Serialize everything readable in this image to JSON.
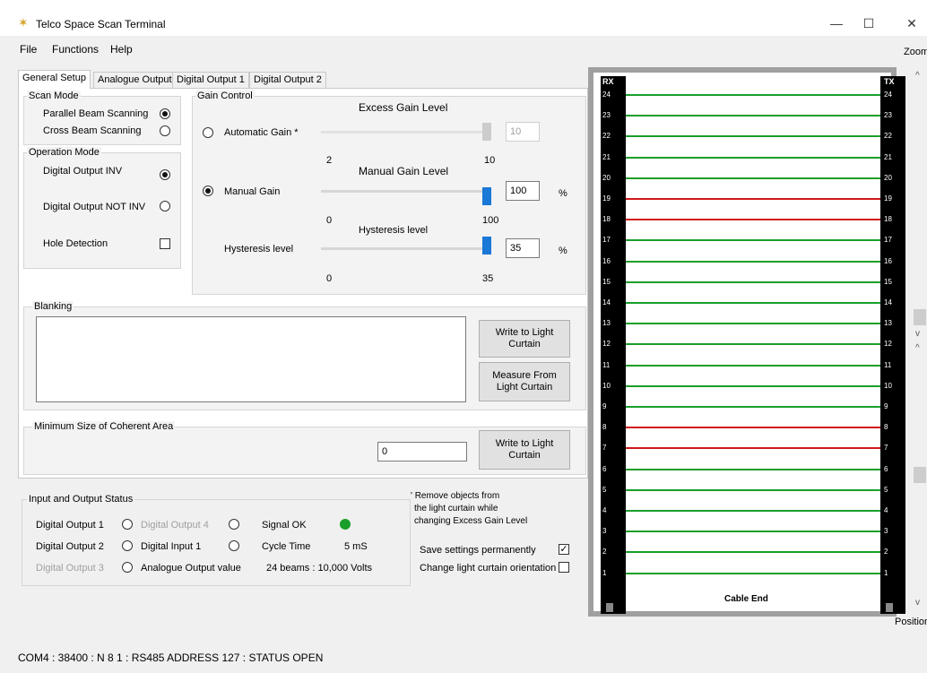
{
  "window": {
    "title": "Telco Space Scan Terminal",
    "minimize": "—",
    "maximize": "☐",
    "close": "✕"
  },
  "menu": {
    "file": "File",
    "functions": "Functions",
    "help": "Help"
  },
  "zoom_label": "Zoom",
  "position_label": "Position",
  "tabs": [
    "General Setup",
    "Analogue Output",
    "Digital Output 1",
    "Digital Output 2"
  ],
  "scan_mode": {
    "title": "Scan Mode",
    "parallel": "Parallel Beam Scanning",
    "cross": "Cross Beam Scanning",
    "selected": "parallel"
  },
  "operation_mode": {
    "title": "Operation Mode",
    "inv": "Digital Output INV",
    "not_inv": "Digital Output NOT INV",
    "hole": "Hole Detection",
    "hole_checked": false
  },
  "gain": {
    "title": "Gain Control",
    "excess_title": "Excess Gain Level",
    "automatic": "Automatic Gain *",
    "excess_min": "2",
    "excess_max": "10",
    "excess_value": "10",
    "manual_title": "Manual Gain Level",
    "manual": "Manual Gain",
    "manual_min": "0",
    "manual_max": "100",
    "manual_value": "100",
    "manual_unit": "%",
    "hyst_title": "Hysteresis level",
    "hyst_label": "Hysteresis level",
    "hyst_min": "0",
    "hyst_max": "35",
    "hyst_value": "35",
    "hyst_unit": "%"
  },
  "blanking": {
    "title": "Blanking",
    "write": "Write to Light Curtain",
    "measure": "Measure From Light Curtain"
  },
  "min_area": {
    "title": "Minimum Size of Coherent Area",
    "value": "0",
    "write": "Write to  Light Curtain"
  },
  "io_status": {
    "title": "Input and Output Status",
    "do1": "Digital Output 1",
    "do2": "Digital Output 2",
    "do3": "Digital Output 3",
    "do4": "Digital Output 4",
    "di1": "Digital Input 1",
    "aov": "Analogue Output value",
    "signal": "Signal OK",
    "cycle": "Cycle Time",
    "cycle_value": "5 mS",
    "analogue_value": "24 beams : 10,000 Volts"
  },
  "note": {
    "line1": "' Remove objects from",
    "line2": "the light curtain while",
    "line3": "changing Excess Gain Level"
  },
  "options": {
    "save": "Save settings permanently",
    "save_checked": true,
    "orientation": "Change light curtain orientation",
    "orientation_checked": false
  },
  "curtain": {
    "rx": "RX",
    "tx": "TX",
    "cable_end": "Cable End",
    "beams": [
      {
        "n": "24",
        "c": "green"
      },
      {
        "n": "23",
        "c": "green"
      },
      {
        "n": "22",
        "c": "green"
      },
      {
        "n": "21",
        "c": "green"
      },
      {
        "n": "20",
        "c": "green"
      },
      {
        "n": "19",
        "c": "red"
      },
      {
        "n": "18",
        "c": "red"
      },
      {
        "n": "17",
        "c": "green"
      },
      {
        "n": "16",
        "c": "green"
      },
      {
        "n": "15",
        "c": "green"
      },
      {
        "n": "14",
        "c": "green"
      },
      {
        "n": "13",
        "c": "green"
      },
      {
        "n": "12",
        "c": "green"
      },
      {
        "n": "11",
        "c": "green"
      },
      {
        "n": "10",
        "c": "green"
      },
      {
        "n": "9",
        "c": "green"
      },
      {
        "n": "8",
        "c": "red"
      },
      {
        "n": "7",
        "c": "red"
      },
      {
        "n": "6",
        "c": "green"
      },
      {
        "n": "5",
        "c": "green"
      },
      {
        "n": "4",
        "c": "green"
      },
      {
        "n": "3",
        "c": "green"
      },
      {
        "n": "2",
        "c": "green"
      },
      {
        "n": "1",
        "c": "green"
      }
    ],
    "colors": {
      "green": "#1a9e2a",
      "red": "#d01818"
    }
  },
  "statusbar": "COM4 : 38400 : N 8 1 : RS485 ADDRESS  127 : STATUS  OPEN"
}
